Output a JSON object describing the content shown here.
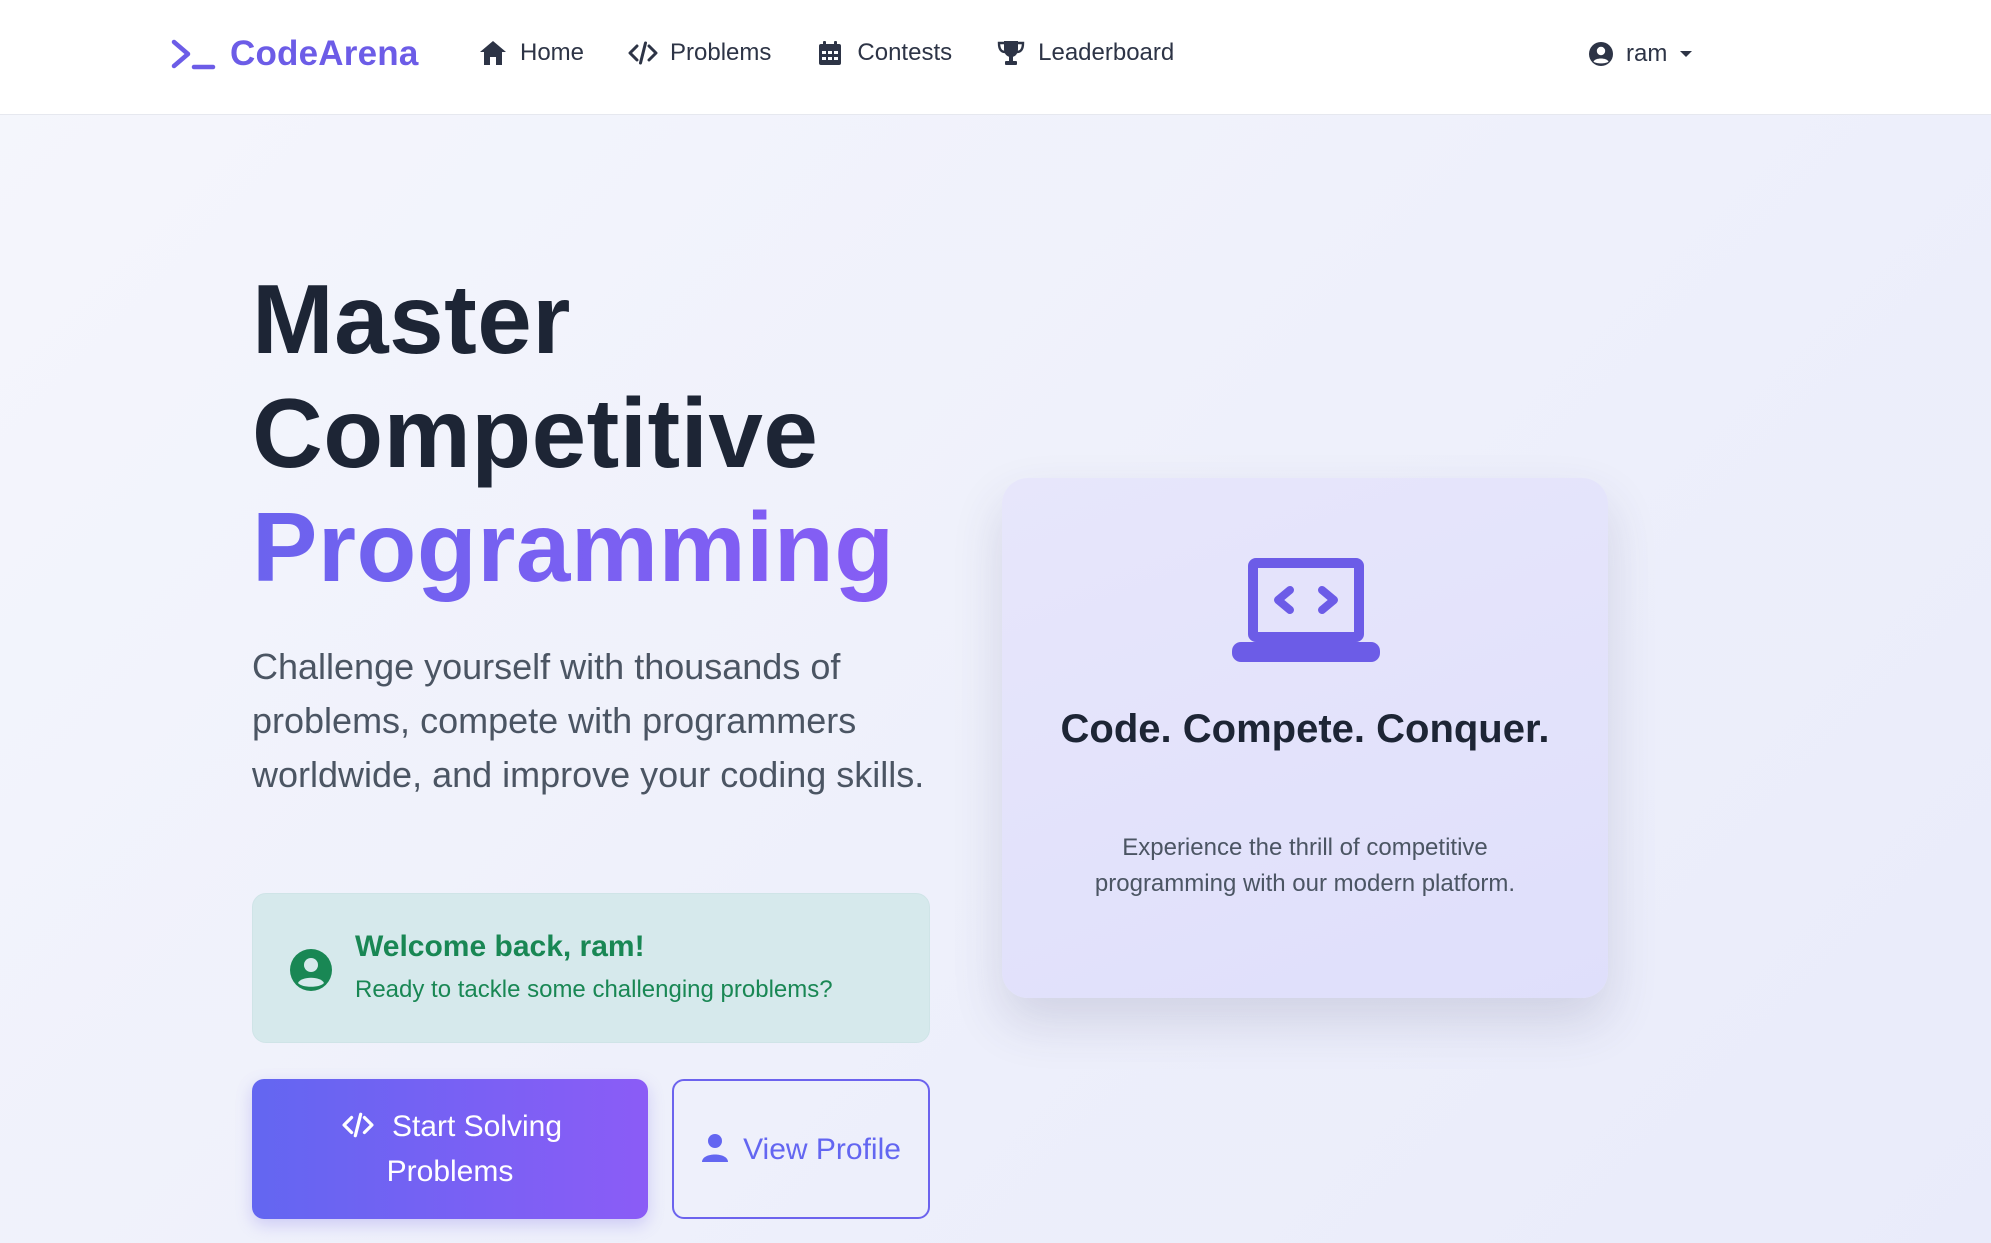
{
  "colors": {
    "brand": "#6c5ce7",
    "accent_gradient_start": "#6366f1",
    "accent_gradient_end": "#8b5cf6",
    "success": "#198754",
    "text_dark": "#1d2535"
  },
  "navbar": {
    "brand": {
      "icon": "terminal-prompt-icon",
      "name": "CodeArena"
    },
    "links": [
      {
        "icon": "home-icon",
        "label": "Home"
      },
      {
        "icon": "code-icon",
        "label": "Problems"
      },
      {
        "icon": "calendar-icon",
        "label": "Contests"
      },
      {
        "icon": "trophy-icon",
        "label": "Leaderboard"
      }
    ],
    "user": {
      "icon": "user-circle-icon",
      "name": "ram",
      "caret": "chevron-down-icon"
    }
  },
  "hero": {
    "title_line1": "Master",
    "title_line2": "Competitive",
    "title_accent": "Programming",
    "subtitle": "Challenge yourself with thousands of problems, compete with programmers worldwide, and improve your coding skills.",
    "welcome": {
      "icon": "user-circle-icon",
      "title": "Welcome back, ram!",
      "text": "Ready to tackle some challenging problems?"
    },
    "buttons": {
      "primary": {
        "icon": "code-icon",
        "label": "Start Solving Problems"
      },
      "secondary": {
        "icon": "user-icon",
        "label": "View Profile"
      }
    }
  },
  "feature_card": {
    "icon": "laptop-code-icon",
    "title": "Code. Compete. Conquer.",
    "text": "Experience the thrill of competitive programming with our modern platform."
  }
}
